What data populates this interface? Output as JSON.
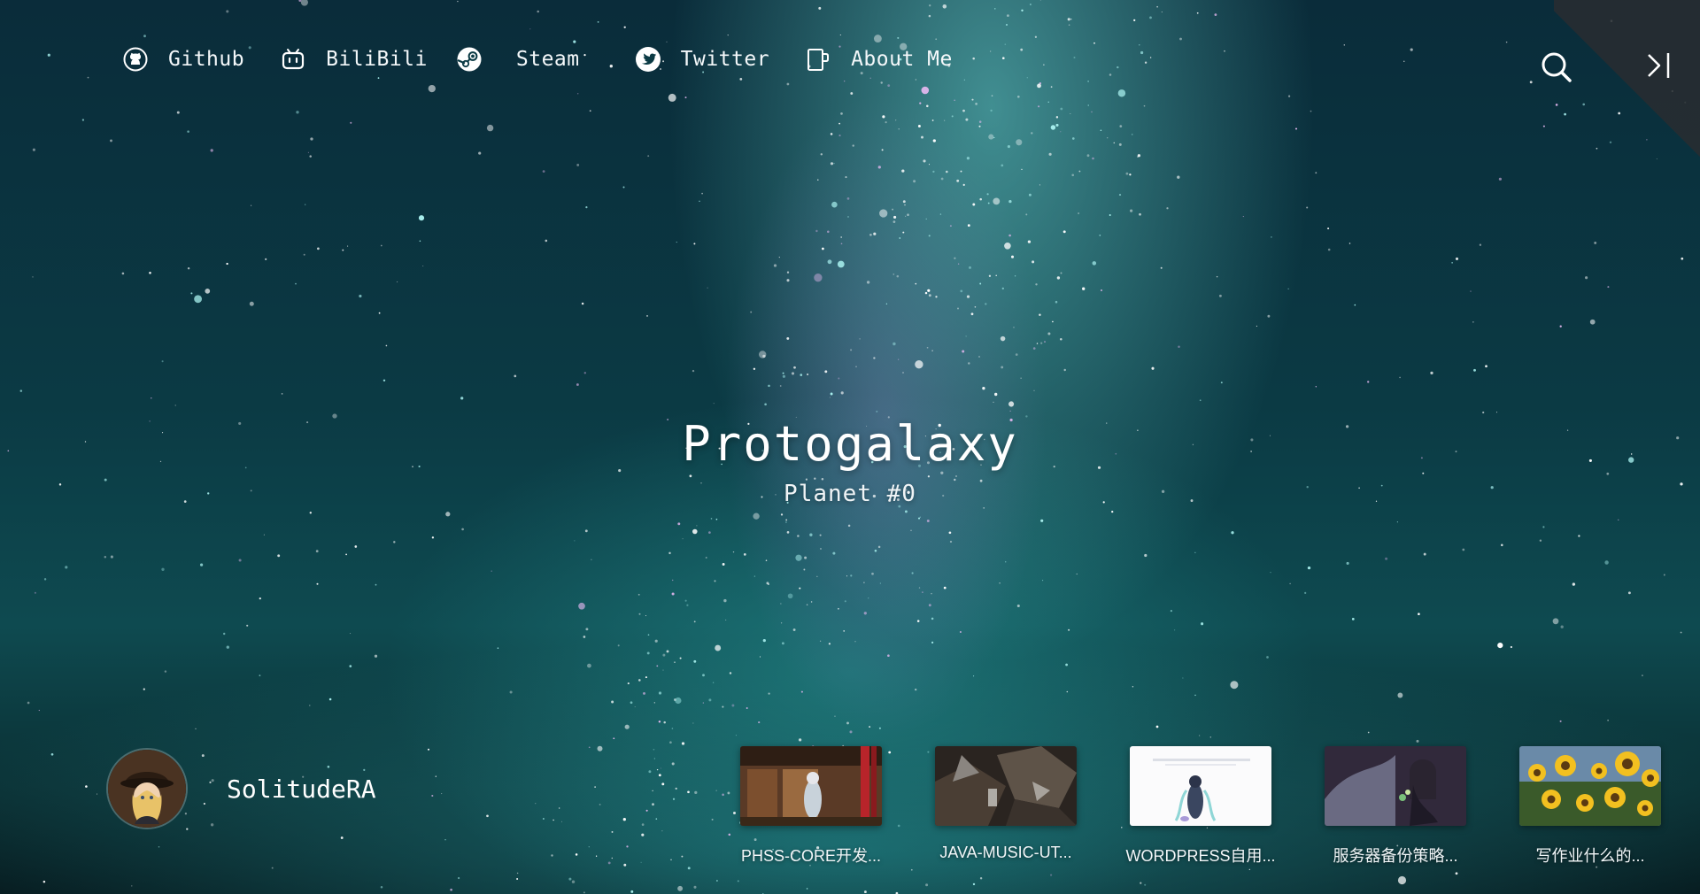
{
  "nav": {
    "items": [
      {
        "label": "Github",
        "icon": "github-icon"
      },
      {
        "label": "BiliBili",
        "icon": "bilibili-icon"
      },
      {
        "label": "Steam",
        "icon": "steam-icon"
      },
      {
        "label": "Twitter",
        "icon": "twitter-icon"
      },
      {
        "label": "About Me",
        "icon": "mug-icon"
      }
    ],
    "search_icon": "search-icon",
    "drawer_icon": "sidebar-toggle-icon"
  },
  "hero": {
    "title": "Protogalaxy",
    "subtitle": "Planet #0"
  },
  "author": {
    "name": "SolitudeRA"
  },
  "posts": [
    {
      "title": "PHSS-CORE开发..."
    },
    {
      "title": "JAVA-MUSIC-UT..."
    },
    {
      "title": "WORDPRESS自用..."
    },
    {
      "title": "服务器备份策略..."
    },
    {
      "title": "写作业什么的..."
    }
  ],
  "colors": {
    "text": "#ffffff",
    "sky_teal": "#0e4a50",
    "corner": "#282c30"
  }
}
